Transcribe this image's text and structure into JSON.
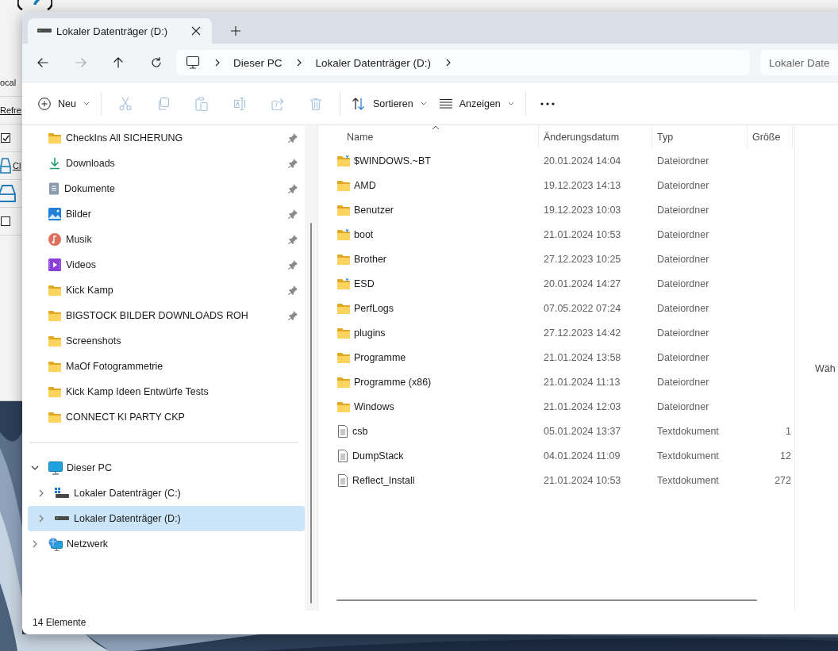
{
  "background_window": {
    "texts": [
      {
        "kind": "label",
        "text": "ocal"
      },
      {
        "kind": "link",
        "text": "Refre"
      },
      {
        "kind": "checkbox",
        "checked": true
      },
      {
        "kind": "drive-link",
        "text": "Cl"
      },
      {
        "kind": "drive"
      },
      {
        "kind": "checkbox",
        "checked": false
      }
    ]
  },
  "tabs": [
    {
      "label": "Lokaler Datenträger (D:)",
      "selected": true
    }
  ],
  "nav": [
    {
      "kind": "back",
      "disabled": false
    },
    {
      "kind": "forward",
      "disabled": true
    },
    {
      "kind": "up",
      "disabled": false
    },
    {
      "kind": "refresh",
      "disabled": false
    }
  ],
  "breadcrumbs": [
    "Dieser PC",
    "Lokaler Datenträger (D:)"
  ],
  "search": {
    "placeholder": "Lokaler Date"
  },
  "toolbar": {
    "new_label": "Neu",
    "actions": [
      {
        "kind": "cut",
        "disabled": true
      },
      {
        "kind": "copy",
        "disabled": true
      },
      {
        "kind": "paste",
        "disabled": true
      },
      {
        "kind": "rename",
        "disabled": true
      },
      {
        "kind": "share",
        "disabled": true
      },
      {
        "kind": "delete",
        "disabled": true
      }
    ],
    "sort_label": "Sortieren",
    "view_label": "Anzeigen"
  },
  "sidebar": {
    "quick_access": [
      {
        "label": "CheckIns All SICHERUNG",
        "kind": "folder",
        "pinned": true,
        "selected": false
      },
      {
        "label": "Downloads",
        "kind": "downloads",
        "pinned": true,
        "selected": false
      },
      {
        "label": "Dokumente",
        "kind": "documents",
        "pinned": true,
        "selected": false
      },
      {
        "label": "Bilder",
        "kind": "pictures",
        "pinned": true,
        "selected": false
      },
      {
        "label": "Musik",
        "kind": "music",
        "pinned": true,
        "selected": false
      },
      {
        "label": "Videos",
        "kind": "videos",
        "pinned": true,
        "selected": false
      },
      {
        "label": "Kick Kamp",
        "kind": "folder",
        "pinned": true,
        "selected": false
      },
      {
        "label": "BIGSTOCK BILDER DOWNLOADS ROH",
        "kind": "folder",
        "pinned": true,
        "selected": false
      },
      {
        "label": "Screenshots",
        "kind": "folder",
        "pinned": false,
        "selected": false
      },
      {
        "label": "MaOf Fotogrammetrie",
        "kind": "folder",
        "pinned": false,
        "selected": false
      },
      {
        "label": "Kick Kamp Ideen Entwürfe Tests",
        "kind": "folder",
        "pinned": false,
        "selected": false
      },
      {
        "label": "CONNECT KI PARTY CKP",
        "kind": "folder",
        "pinned": false,
        "selected": false
      }
    ],
    "tree": [
      {
        "label": "Dieser PC",
        "kind": "pc",
        "expanded": true,
        "selected": false,
        "children": [
          {
            "label": "Lokaler Datenträger (C:)",
            "kind": "system-drive",
            "expanded": false,
            "selected": false
          },
          {
            "label": "Lokaler Datenträger (D:)",
            "kind": "drive",
            "expanded": false,
            "selected": true
          }
        ]
      },
      {
        "label": "Netzwerk",
        "kind": "network",
        "expanded": false,
        "selected": false
      }
    ]
  },
  "table": {
    "columns": [
      {
        "label": "Name",
        "sorted": true
      },
      {
        "label": "Änderungsdatum",
        "sorted": false
      },
      {
        "label": "Typ",
        "sorted": false
      },
      {
        "label": "Größe",
        "sorted": false
      }
    ],
    "rows": [
      {
        "name": "$WINDOWS.~BT",
        "kind": "special-folder",
        "date": "20.01.2024 14:04",
        "type": "Dateiordner"
      },
      {
        "name": "AMD",
        "kind": "folder",
        "date": "19.12.2023 14:13",
        "type": "Dateiordner"
      },
      {
        "name": "Benutzer",
        "kind": "folder",
        "date": "19.12.2023 10:03",
        "type": "Dateiordner"
      },
      {
        "name": "boot",
        "kind": "special-folder",
        "date": "21.01.2024 10:53",
        "type": "Dateiordner"
      },
      {
        "name": "Brother",
        "kind": "folder",
        "date": "27.12.2023 10:25",
        "type": "Dateiordner"
      },
      {
        "name": "ESD",
        "kind": "special-folder",
        "date": "20.01.2024 14:27",
        "type": "Dateiordner"
      },
      {
        "name": "PerfLogs",
        "kind": "folder",
        "date": "07.05.2022 07:24",
        "type": "Dateiordner"
      },
      {
        "name": "plugins",
        "kind": "folder",
        "date": "27.12.2023 14:42",
        "type": "Dateiordner"
      },
      {
        "name": "Programme",
        "kind": "folder",
        "date": "21.01.2024 13:58",
        "type": "Dateiordner"
      },
      {
        "name": "Programme (x86)",
        "kind": "folder",
        "date": "21.01.2024 11:13",
        "type": "Dateiordner"
      },
      {
        "name": "Windows",
        "kind": "folder",
        "date": "21.01.2024 12:03",
        "type": "Dateiordner"
      },
      {
        "name": "csb",
        "kind": "text",
        "date": "05.01.2024 13:37",
        "type": "Textdokument",
        "size": "1"
      },
      {
        "name": "DumpStack",
        "kind": "text",
        "date": "04.01.2024 11:09",
        "type": "Textdokument",
        "size": "12"
      },
      {
        "name": "Reflect_Install",
        "kind": "text",
        "date": "21.01.2024 10:53",
        "type": "Textdokument",
        "size": "272"
      }
    ]
  },
  "details_pane": {
    "text": "Wäh"
  },
  "status_bar": {
    "count": "14 Elemente"
  }
}
